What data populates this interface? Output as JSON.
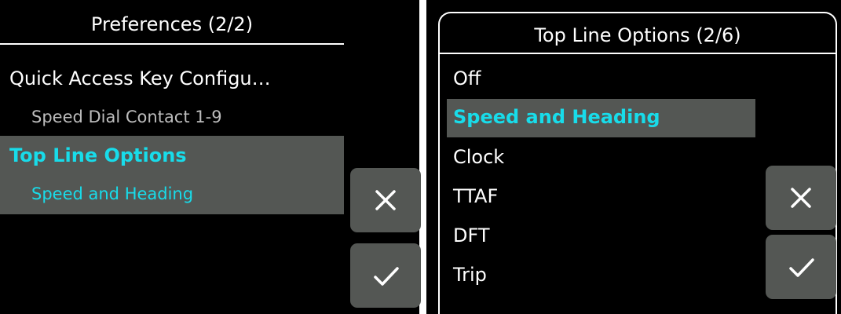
{
  "left_screen": {
    "title": "Preferences (2/2)",
    "items": [
      {
        "label": "Quick Access Key Configu…",
        "value": "Speed Dial Contact 1-9",
        "selected": false
      },
      {
        "label": "Top Line Options",
        "value": "Speed and Heading",
        "selected": true
      }
    ],
    "buttons": {
      "cancel_icon": "close-icon",
      "confirm_icon": "check-icon"
    }
  },
  "right_screen": {
    "title": "Top Line Options (2/6)",
    "options": [
      "Off",
      "Speed and Heading",
      "Clock",
      "TTAF",
      "DFT",
      "Trip"
    ],
    "selected_option": "Speed and Heading",
    "buttons": {
      "cancel_icon": "close-icon",
      "confirm_icon": "check-icon"
    }
  },
  "colors": {
    "background": "#000000",
    "highlight_bg": "#545754",
    "accent": "#18dcea",
    "text": "#ffffff",
    "sub_text": "#bdbdbd",
    "button_bg": "#545754"
  }
}
